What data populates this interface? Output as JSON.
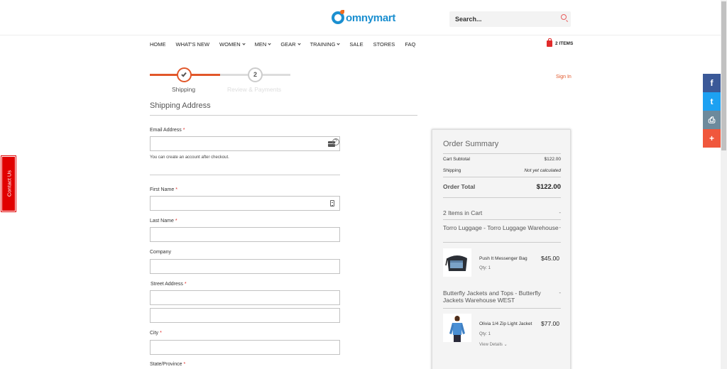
{
  "header": {
    "logo_text": "omnymart",
    "search_placeholder": "Search..."
  },
  "nav": {
    "items": [
      {
        "label": "HOME",
        "has_dropdown": false
      },
      {
        "label": "WHAT'S NEW",
        "has_dropdown": false
      },
      {
        "label": "WOMEN",
        "has_dropdown": true
      },
      {
        "label": "MEN",
        "has_dropdown": true
      },
      {
        "label": "GEAR",
        "has_dropdown": true
      },
      {
        "label": "TRAINING",
        "has_dropdown": true
      },
      {
        "label": "SALE",
        "has_dropdown": false
      },
      {
        "label": "STORES",
        "has_dropdown": false
      },
      {
        "label": "FAQ",
        "has_dropdown": false
      }
    ],
    "cart_label": "2 ITEMS"
  },
  "progress": {
    "step1_label": "Shipping",
    "step2_number": "2",
    "step2_label": "Review & Payments"
  },
  "signin_label": "Sign In",
  "form": {
    "title": "Shipping Address",
    "email_label": "Email Address",
    "email_note": "You can create an account after checkout.",
    "first_name_label": "First Name",
    "last_name_label": "Last Name",
    "company_label": "Company",
    "street_label": "Street Address",
    "city_label": "City",
    "state_label": "State/Province",
    "required_mark": "*",
    "help_glyph": "?"
  },
  "summary": {
    "title": "Order Summary",
    "subtotal_label": "Cart Subtotal",
    "subtotal_value": "$122.00",
    "shipping_label": "Shipping",
    "shipping_value": "Not yet calculated",
    "total_label": "Order Total",
    "total_value": "$122.00",
    "items_in_cart": "2 Items in Cart",
    "toggle_glyph": "-",
    "groups": [
      {
        "warehouse": "Torro Luggage - Torro Luggage Warehouse",
        "product": "Push It Messenger Bag",
        "price": "$45.00",
        "qty": "Qty: 1"
      },
      {
        "warehouse": "Butterfly Jackets and Tops - Butterfly Jackets Warehouse WEST",
        "product": "Olivia 1/4 Zip Light Jacket",
        "price": "$77.00",
        "qty": "Qty: 1",
        "view_details": "View Details"
      }
    ]
  },
  "contact_tab": "Contact Us",
  "social": [
    {
      "icon": "facebook-icon",
      "glyph": "f",
      "color": "#3b5998"
    },
    {
      "icon": "twitter-icon",
      "glyph": "t",
      "color": "#1da1f2"
    },
    {
      "icon": "print-icon",
      "glyph": "⎙",
      "color": "#6d8a9c"
    },
    {
      "icon": "plus-icon",
      "glyph": "+",
      "color": "#f0573c"
    }
  ],
  "colors": {
    "accent": "#e1572a",
    "brand_blue": "#1b8fd0",
    "contact_red": "#e10000"
  }
}
